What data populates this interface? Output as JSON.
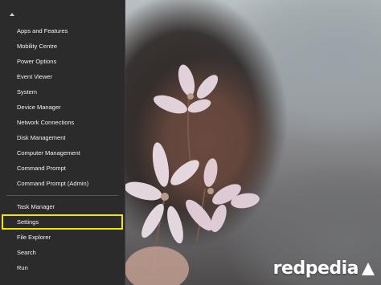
{
  "menu": {
    "group1": [
      {
        "label": "Apps and Features"
      },
      {
        "label": "Mobility Centre"
      },
      {
        "label": "Power Options"
      },
      {
        "label": "Event Viewer"
      },
      {
        "label": "System"
      },
      {
        "label": "Device Manager"
      },
      {
        "label": "Network Connections"
      },
      {
        "label": "Disk Management"
      },
      {
        "label": "Computer Management"
      },
      {
        "label": "Command Prompt"
      },
      {
        "label": "Command Prompt (Admin)"
      }
    ],
    "group2": [
      {
        "label": "Task Manager"
      },
      {
        "label": "Settings",
        "highlighted": true
      },
      {
        "label": "File Explorer"
      },
      {
        "label": "Search"
      },
      {
        "label": "Run"
      }
    ]
  },
  "watermark": {
    "text": "redpedia"
  },
  "colors": {
    "menu_bg": "#2b2b2b",
    "menu_text": "#f2f2f2",
    "highlight_outline": "#f5e600"
  }
}
